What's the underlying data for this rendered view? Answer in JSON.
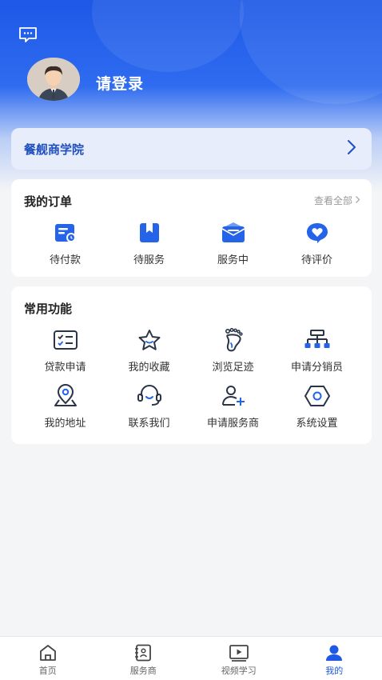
{
  "header": {
    "message_icon": "message-icon",
    "login_prompt": "请登录"
  },
  "academy": {
    "label": "餐舰商学院",
    "arrow_icon": "chevron-right-icon"
  },
  "orders": {
    "title": "我的订单",
    "view_all": "查看全部",
    "items": [
      {
        "label": "待付款",
        "icon": "payment-pending-icon"
      },
      {
        "label": "待服务",
        "icon": "service-pending-icon"
      },
      {
        "label": "服务中",
        "icon": "in-service-icon"
      },
      {
        "label": "待评价",
        "icon": "review-pending-icon"
      }
    ]
  },
  "functions": {
    "title": "常用功能",
    "items": [
      {
        "label": "贷款申请",
        "icon": "loan-application-icon"
      },
      {
        "label": "我的收藏",
        "icon": "star-icon"
      },
      {
        "label": "浏览足迹",
        "icon": "footprint-icon"
      },
      {
        "label": "申请分销员",
        "icon": "org-chart-icon"
      },
      {
        "label": "我的地址",
        "icon": "location-pin-icon"
      },
      {
        "label": "联系我们",
        "icon": "headset-icon"
      },
      {
        "label": "申请服务商",
        "icon": "add-user-icon"
      },
      {
        "label": "系统设置",
        "icon": "settings-icon"
      }
    ]
  },
  "tabbar": {
    "items": [
      {
        "label": "首页",
        "icon": "home-icon",
        "active": false
      },
      {
        "label": "服务商",
        "icon": "contacts-icon",
        "active": false
      },
      {
        "label": "视频学习",
        "icon": "video-play-icon",
        "active": false
      },
      {
        "label": "我的",
        "icon": "profile-icon",
        "active": true
      }
    ]
  },
  "colors": {
    "primary": "#1d58e6",
    "academy_text": "#1f4fbf",
    "icon_dark": "#2a3548"
  }
}
